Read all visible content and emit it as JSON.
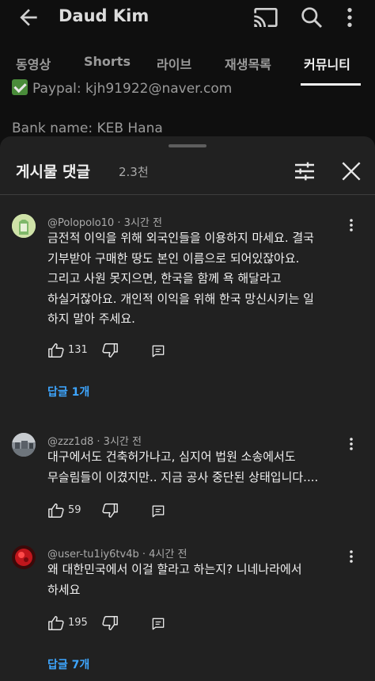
{
  "header": {
    "channel_name": "Daud Kim",
    "icons": [
      "back-arrow-icon",
      "cast-icon",
      "search-icon",
      "more-vert-icon"
    ]
  },
  "tabs": [
    {
      "label": "동영상",
      "active": false
    },
    {
      "label": "Shorts",
      "active": false
    },
    {
      "label": "라이브",
      "active": false
    },
    {
      "label": "재생목록",
      "active": false
    },
    {
      "label": "커뮤니티",
      "active": true
    }
  ],
  "background_post": {
    "line1": "Paypal: kjh91922@naver.com",
    "line2": "Bank name: KEB Hana"
  },
  "comments_sheet": {
    "title": "게시물 댓글",
    "count": "2.3천"
  },
  "comments": [
    {
      "author": "@Polopolo10",
      "time": "3시간 전",
      "lines": [
        "금전적 이익을 위해 외국인들을 이용하지 마세요. 결국",
        "기부받아 구매한 땅도 본인 이름으로 되어있잖아요.",
        "그리고 사원 못지으면, 한국을 함께 욕 해달라고",
        "하실거잖아요. 개인적 이익을 위해 한국 망신시키는 일",
        "하지 말아 주세요."
      ],
      "likes": "131",
      "replies": "답글 1개"
    },
    {
      "author": "@zzz1d8",
      "time": "3시간 전",
      "lines": [
        "대구에서도 건축허가나고, 심지어 법원 소송에서도",
        "무슬림들이 이겼지만.. 지금 공사 중단된 상태입니다...."
      ],
      "likes": "59",
      "replies": ""
    },
    {
      "author": "@user-tu1iy6tv4b",
      "time": "4시간 전",
      "lines": [
        "왜 대한민국에서 이걸 할라고 하는지? 니네나라에서",
        "하세요"
      ],
      "likes": "195",
      "replies": "답글 7개"
    }
  ],
  "colors": {
    "background": "#0f0f0f",
    "sheet": "#212121",
    "link": "#3ea6ff",
    "secondary_text": "#aaaaaa"
  }
}
